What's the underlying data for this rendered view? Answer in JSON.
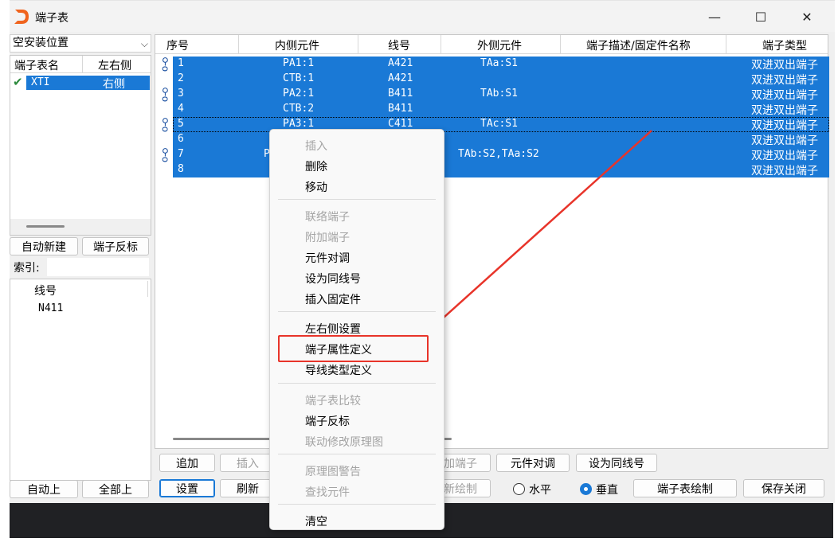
{
  "window": {
    "title": "端子表",
    "controls": {
      "minimize": "—",
      "maximize": "☐",
      "close": "✕"
    }
  },
  "left_panel": {
    "location_combo": "空安装位置",
    "table_headers": [
      "端子表名",
      "左右侧"
    ],
    "rows": [
      {
        "name": "XTI",
        "side": "右侧",
        "checked": true
      }
    ],
    "buttons": {
      "auto_new": "自动新建",
      "reverse": "端子反标",
      "auto_up": "自动上",
      "all_up": "全部上"
    },
    "index_label": "索引:",
    "wire_list": {
      "header": "线号",
      "items": [
        "N411"
      ]
    }
  },
  "grid": {
    "headers": [
      "序号",
      "内侧元件",
      "线号",
      "外侧元件",
      "端子描述/固定件名称",
      "端子类型"
    ],
    "rows": [
      {
        "no": "1",
        "inner": "PA1:1",
        "wire": "A421",
        "outer": "TAa:S1",
        "type": "双进双出端子"
      },
      {
        "no": "2",
        "inner": "CTB:1",
        "wire": "A421",
        "outer": "",
        "type": "双进双出端子"
      },
      {
        "no": "3",
        "inner": "PA2:1",
        "wire": "B411",
        "outer": "TAb:S1",
        "type": "双进双出端子"
      },
      {
        "no": "4",
        "inner": "CTB:2",
        "wire": "B411",
        "outer": "",
        "type": "双进双出端子"
      },
      {
        "no": "5",
        "inner": "PA3:1",
        "wire": "C411",
        "outer": "TAc:S1",
        "type": "双进双出端子"
      },
      {
        "no": "6",
        "inner": "",
        "wire": "",
        "outer": "",
        "type": "双进双出端子"
      },
      {
        "no": "7",
        "inner": "P",
        "wire": "",
        "outer": "TAb:S2,TAa:S2",
        "type": "双进双出端子"
      },
      {
        "no": "8",
        "inner": "",
        "wire": "",
        "outer": "",
        "type": "双进双出端子"
      }
    ]
  },
  "bottom": {
    "row1": {
      "add": "追加",
      "insert": "插入",
      "add_terminal": "加端子",
      "swap": "元件对调",
      "same_wire": "设为同线号"
    },
    "row2": {
      "settings": "设置",
      "refresh": "刷新",
      "redraw": "新绘制",
      "horizontal": "水平",
      "vertical": "垂直",
      "draw_table": "端子表绘制",
      "save_close": "保存关闭"
    },
    "orientation": "vertical"
  },
  "context_menu": {
    "items": [
      {
        "label": "插入",
        "enabled": false
      },
      {
        "label": "删除",
        "enabled": true
      },
      {
        "label": "移动",
        "enabled": true
      },
      {
        "label": "联络端子",
        "enabled": false
      },
      {
        "label": "附加端子",
        "enabled": false
      },
      {
        "label": "元件对调",
        "enabled": true
      },
      {
        "label": "设为同线号",
        "enabled": true
      },
      {
        "label": "插入固定件",
        "enabled": true
      },
      {
        "label": "左右侧设置",
        "enabled": true
      },
      {
        "label": "端子属性定义",
        "enabled": true,
        "highlighted": true
      },
      {
        "label": "导线类型定义",
        "enabled": true
      },
      {
        "label": "端子表比较",
        "enabled": false
      },
      {
        "label": "端子反标",
        "enabled": true
      },
      {
        "label": "联动修改原理图",
        "enabled": false
      },
      {
        "label": "原理图警告",
        "enabled": false
      },
      {
        "label": "查找元件",
        "enabled": false
      },
      {
        "label": "清空",
        "enabled": true
      }
    ]
  },
  "colors": {
    "selection": "#1a79d6",
    "annotation": "#e8342a",
    "logo": "#f0641e"
  }
}
